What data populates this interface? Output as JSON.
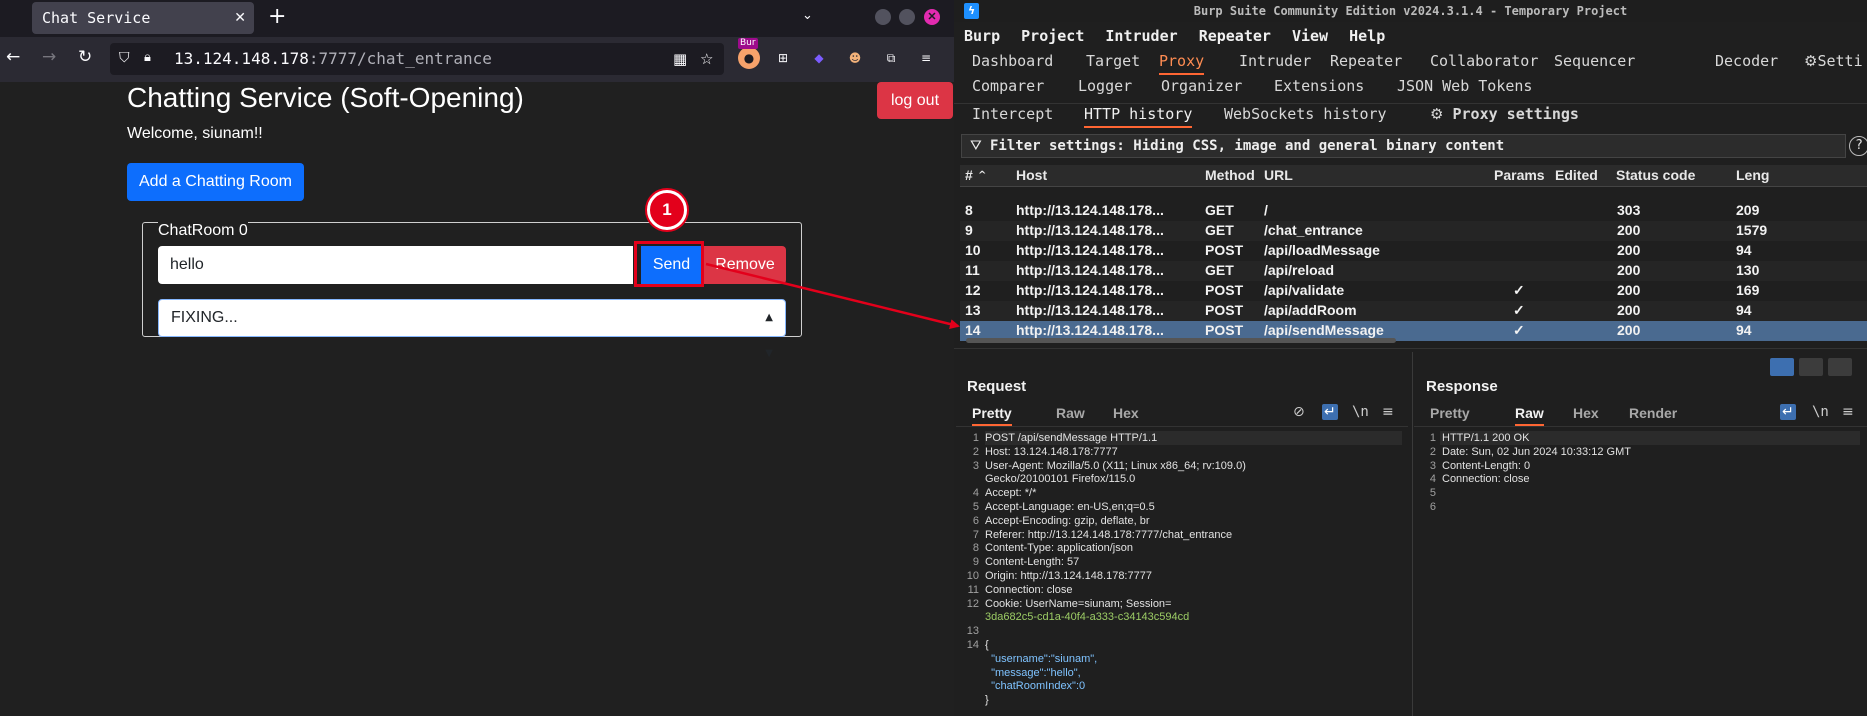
{
  "browser": {
    "tab_title": "Chat Service",
    "tab_close": "✕",
    "new_tab": "+",
    "tab_list": "⌄",
    "url_host": "13.124.148.178",
    "url_rest": ":7777/chat_entrance",
    "burp_tag": "Bur"
  },
  "page": {
    "title": "Chatting Service (Soft-Opening)",
    "welcome": "Welcome, siunam!!",
    "logout": "log out",
    "add_room": "Add a Chatting Room",
    "room_name": "ChatRoom 0",
    "message_value": "hello",
    "send": "Send",
    "remove": "Remove",
    "select_value": "FIXING...",
    "annotation_number": "1"
  },
  "burp": {
    "window_title": "Burp Suite Community Edition v2024.3.1.4 - Temporary Project",
    "menu": [
      "Burp",
      "Project",
      "Intruder",
      "Repeater",
      "View",
      "Help"
    ],
    "tabs_row1": [
      "Dashboard",
      "Target",
      "Proxy",
      "Intruder",
      "Repeater",
      "Collaborator",
      "Sequencer",
      "Decoder",
      "Setti"
    ],
    "tabs_row2": [
      "Comparer",
      "Logger",
      "Organizer",
      "Extensions",
      "JSON Web Tokens"
    ],
    "proxy_tabs": [
      "Intercept",
      "HTTP history",
      "WebSockets history",
      "Proxy settings"
    ],
    "filter_text": "Filter settings: Hiding CSS, image and general binary content",
    "columns": [
      "#",
      "Host",
      "Method",
      "URL",
      "Params",
      "Edited",
      "Status code",
      "Leng"
    ],
    "rows": [
      {
        "num": "8",
        "host": "http://13.124.148.178...",
        "method": "GET",
        "url": "/",
        "params": "",
        "status": "303",
        "length": "209"
      },
      {
        "num": "9",
        "host": "http://13.124.148.178...",
        "method": "GET",
        "url": "/chat_entrance",
        "params": "",
        "status": "200",
        "length": "1579"
      },
      {
        "num": "10",
        "host": "http://13.124.148.178...",
        "method": "POST",
        "url": "/api/loadMessage",
        "params": "",
        "status": "200",
        "length": "94"
      },
      {
        "num": "11",
        "host": "http://13.124.148.178...",
        "method": "GET",
        "url": "/api/reload",
        "params": "",
        "status": "200",
        "length": "130"
      },
      {
        "num": "12",
        "host": "http://13.124.148.178...",
        "method": "POST",
        "url": "/api/validate",
        "params": "✓",
        "status": "200",
        "length": "169"
      },
      {
        "num": "13",
        "host": "http://13.124.148.178...",
        "method": "POST",
        "url": "/api/addRoom",
        "params": "✓",
        "status": "200",
        "length": "94"
      },
      {
        "num": "14",
        "host": "http://13.124.148.178...",
        "method": "POST",
        "url": "/api/sendMessage",
        "params": "✓",
        "status": "200",
        "length": "94"
      }
    ],
    "request": {
      "title": "Request",
      "tabs": [
        "Pretty",
        "Raw",
        "Hex"
      ],
      "lines": [
        {
          "n": "1",
          "text": "POST /api/sendMessage HTTP/1.1"
        },
        {
          "n": "2",
          "text": "Host: 13.124.148.178:7777"
        },
        {
          "n": "3",
          "text": "User-Agent: Mozilla/5.0 (X11; Linux x86_64; rv:109.0)"
        },
        {
          "n": "",
          "text": "Gecko/20100101 Firefox/115.0"
        },
        {
          "n": "4",
          "text": "Accept: */*"
        },
        {
          "n": "5",
          "text": "Accept-Language: en-US,en;q=0.5"
        },
        {
          "n": "6",
          "text": "Accept-Encoding: gzip, deflate, br"
        },
        {
          "n": "7",
          "text": "Referer: http://13.124.148.178:7777/chat_entrance"
        },
        {
          "n": "8",
          "text": "Content-Type: application/json"
        },
        {
          "n": "9",
          "text": "Content-Length: 57"
        },
        {
          "n": "10",
          "text": "Origin: http://13.124.148.178:7777"
        },
        {
          "n": "11",
          "text": "Connection: close"
        },
        {
          "n": "12",
          "text": "Cookie: UserName=siunam; Session="
        },
        {
          "n": "",
          "text": "3da682c5-cd1a-40f4-a333-c34143c594cd"
        },
        {
          "n": "13",
          "text": ""
        },
        {
          "n": "14",
          "text": "{"
        },
        {
          "n": "",
          "text": "  \"username\":\"siunam\","
        },
        {
          "n": "",
          "text": "  \"message\":\"hello\","
        },
        {
          "n": "",
          "text": "  \"chatRoomIndex\":0"
        },
        {
          "n": "",
          "text": "}"
        }
      ]
    },
    "response": {
      "title": "Response",
      "tabs": [
        "Pretty",
        "Raw",
        "Hex",
        "Render"
      ],
      "lines": [
        {
          "n": "1",
          "text": "HTTP/1.1 200 OK"
        },
        {
          "n": "2",
          "text": "Date: Sun, 02 Jun 2024 10:33:12 GMT"
        },
        {
          "n": "3",
          "text": "Content-Length: 0"
        },
        {
          "n": "4",
          "text": "Connection: close"
        },
        {
          "n": "5",
          "text": ""
        },
        {
          "n": "6",
          "text": ""
        }
      ]
    },
    "newline_toggle": "\\n"
  },
  "colors": {
    "accent_orange": "#ff6633",
    "selected_row": "#4a6a90",
    "annotation_red": "#e3001b",
    "send_blue": "#0d6efd",
    "danger_red": "#dc3545"
  }
}
